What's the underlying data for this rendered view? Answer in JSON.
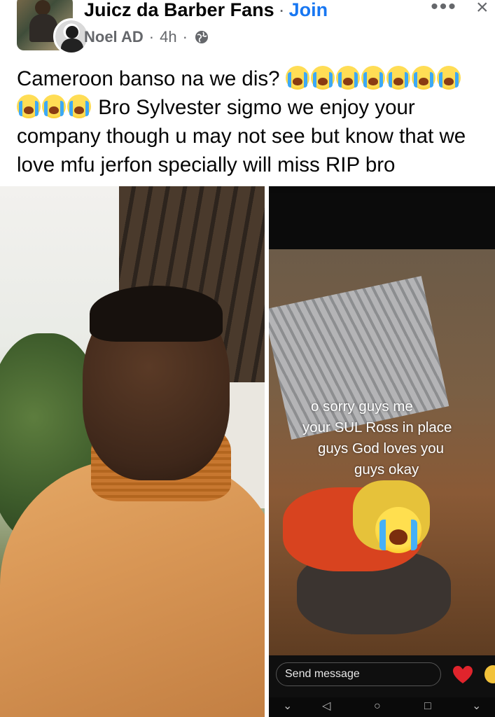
{
  "post": {
    "group_name": "Juicz da Barber Fans",
    "separator": "·",
    "join_label": "Join",
    "author": "Noel AD",
    "time": "4h",
    "meta_sep": "·",
    "more_label": "•••",
    "close_label": "×",
    "text_line1": "Cameroon banso na we dis?",
    "text_line2": "Bro Sylvester sigmo we enjoy your",
    "text_line3": "company though u may not see but know that we",
    "text_line4": "love mfu jerfon specially will miss RIP bro",
    "line1_emoji_count": 7,
    "line2_emoji_count": 3,
    "emoji_name": "loudly-crying-face"
  },
  "photo_right": {
    "story_line1": "o sorry guys me",
    "story_line2": "your SUL Ross in place",
    "story_line3": "guys God loves you",
    "story_line4": "guys okay",
    "send_message_placeholder": "Send message",
    "nav_items": [
      "⌄",
      "◁",
      "○",
      "□",
      "⌄"
    ]
  },
  "colors": {
    "link": "#1877f2",
    "secondary_text": "#65676b",
    "primary_text": "#050505",
    "heart": "#e0242c"
  }
}
